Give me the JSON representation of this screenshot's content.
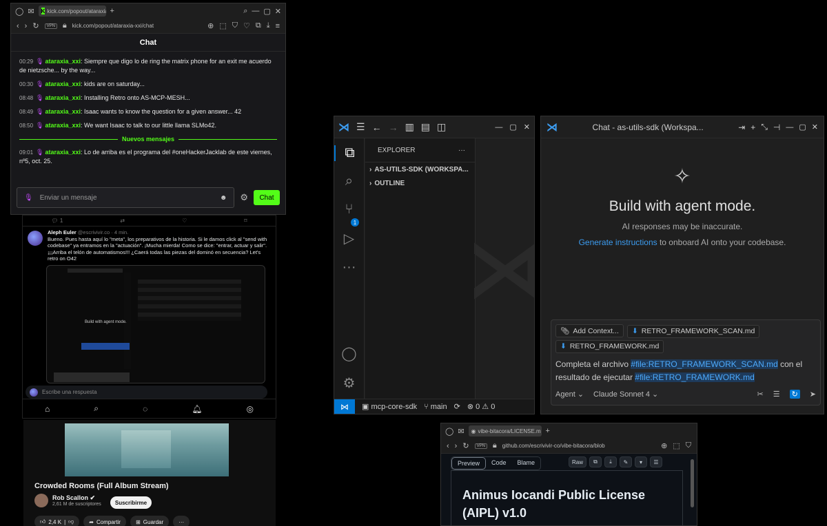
{
  "kick": {
    "tab_title": "kick.com/popout/ataraxia",
    "url": "kick.com/popout/ataraxia-xxi/chat",
    "vpn": "VPN",
    "chat_title": "Chat",
    "messages": [
      {
        "time": "00:29",
        "user": "ataraxia_xxi",
        "text": ": Siempre que digo lo de ring the matrix phone for an exit me acuerdo de nietzsche... by the way..."
      },
      {
        "time": "00:30",
        "user": "ataraxia_xxi",
        "text": ": kids are on saturday..."
      },
      {
        "time": "08:48",
        "user": "ataraxia_xxi",
        "text": ": Installing Retro onto AS-MCP-MESH..."
      },
      {
        "time": "08:49",
        "user": "ataraxia_xxi",
        "text": ": Isaac wants to know the question for a given answer... 42"
      },
      {
        "time": "08:50",
        "user": "ataraxia_xxi",
        "text": ": We want Isaac to talk to our little llama SLMo42."
      }
    ],
    "new_messages_label": "Nuevos mensajes",
    "new_message": {
      "time": "09:01",
      "user": "ataraxia_xxi",
      "text": ": Lo de arriba es el programa del #oneHackerJacklab de este viernes, nº5, oct. 25."
    },
    "input_placeholder": "Enviar un mensaje",
    "send_button": "Chat",
    "accent": "#53fc18"
  },
  "twitter": {
    "reply_count": "1",
    "author_name": "Aleph Euler",
    "author_handle": "@escrivivir.co",
    "time_ago": "· 4 min.",
    "post_text": "Bueno. Pues hasta aquí lo \"meta\", los preparativos de la historia. Si le damos click al \"send with codebase\" ya entramos en la \"actuación\". ¡Mucha mierda! Como se dice: \"entrar, actuar y salir\". ¡¡¡Arriba el telón de automatismos!!! ¿Caerá todas las piezas del dominó en secuencia? Let's retro on O42",
    "embedded_caption": "Build with agent mode.",
    "reply_placeholder": "Escribe una respuesta"
  },
  "youtube": {
    "title": "Crowded Rooms (Full Album Stream)",
    "channel": "Rob Scallon",
    "subscribers": "2,61 M de suscriptores",
    "subscribe_button": "Suscribirme",
    "likes": "2,4 K",
    "share": "Compartir",
    "save": "Guardar",
    "more": "···"
  },
  "vscode": {
    "explorer_title": "EXPLORER",
    "more": "···",
    "workspace_section": "AS-UTILS-SDK (WORKSPA...",
    "outline_section": "OUTLINE",
    "scm_badge": "1",
    "status": {
      "repo": "mcp-core-sdk",
      "branch": "main",
      "errors": "0",
      "warnings": "0"
    },
    "accent": "#0078d4"
  },
  "copilot": {
    "title": "Chat - as-utils-sdk (Workspa...",
    "hero_title": "Build with agent mode.",
    "disclaimer": "AI responses may be inaccurate.",
    "generate_link": "Generate instructions",
    "generate_rest": " to onboard AI onto your codebase.",
    "add_context": "Add Context...",
    "chip1": "RETRO_FRAMEWORK_SCAN.md",
    "chip2": "RETRO_FRAMEWORK.md",
    "prompt_pre": "Completa el archivo ",
    "prompt_ref1": "#file:RETRO_FRAMEWORK_SCAN.md",
    "prompt_mid": " con el resultado de ejecutar ",
    "prompt_ref2": "#file:RETRO_FRAMEWORK.md",
    "mode": "Agent",
    "model": "Claude Sonnet 4"
  },
  "github": {
    "tab_title": "vibe-bitacora/LICENSE.m",
    "url": "github.com/escrivivir-co/vibe-bitacora/blob",
    "vpn": "VPN",
    "tabs": [
      "Preview",
      "Code",
      "Blame"
    ],
    "raw": "Raw",
    "heading": "Animus Iocandi Public License (AIPL) v1.0"
  }
}
